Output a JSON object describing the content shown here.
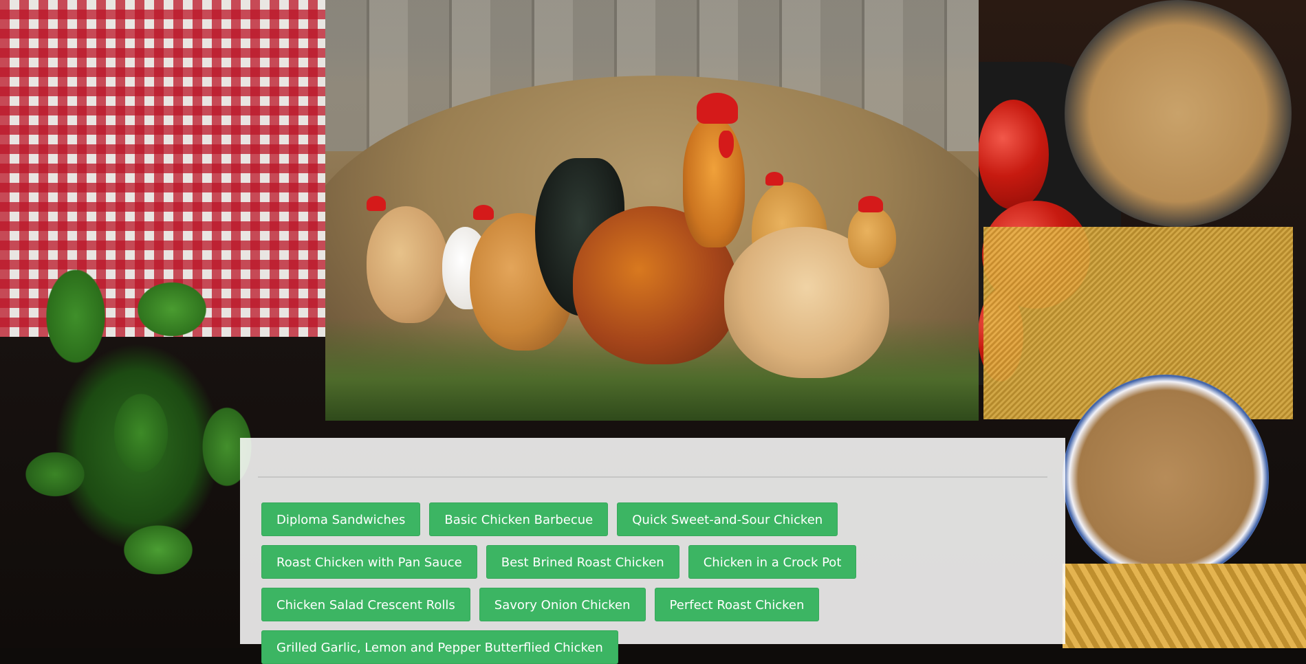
{
  "recipes": {
    "buttons": [
      "Diploma Sandwiches",
      "Basic Chicken Barbecue",
      "Quick Sweet-and-Sour Chicken",
      "Roast Chicken with Pan Sauce",
      "Best Brined Roast Chicken",
      "Chicken in a Crock Pot",
      "Chicken Salad Crescent Rolls",
      "Savory Onion Chicken",
      "Perfect Roast Chicken",
      "Grilled Garlic, Lemon and Pepper Butterflied Chicken"
    ]
  },
  "colors": {
    "button_bg": "#3cb563",
    "button_text": "#ffffff",
    "panel_bg": "rgba(255,255,255,0.86)"
  }
}
